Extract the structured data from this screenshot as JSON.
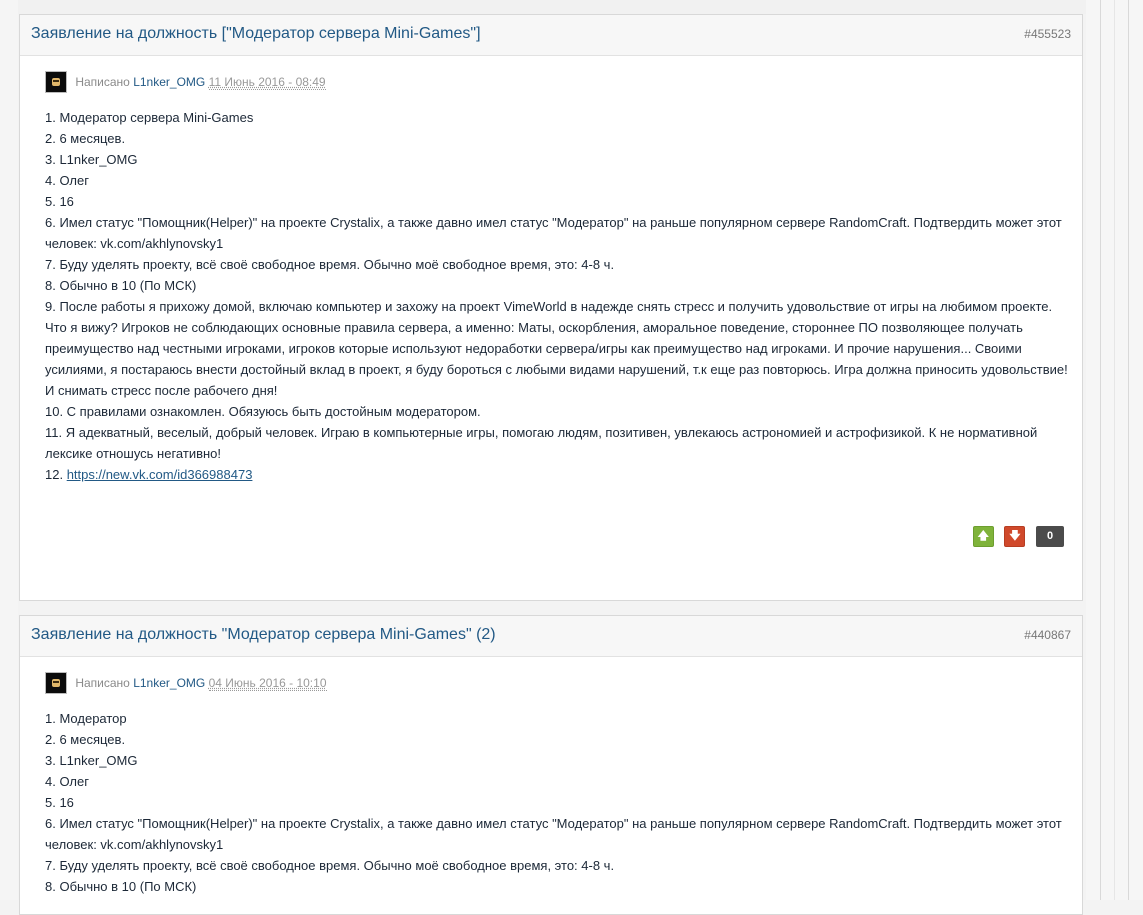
{
  "posts": [
    {
      "title": "Заявление на должность [\"Модератор сервера Mini-Games\"]",
      "number": "#455523",
      "written_by": "Написано",
      "author": "L1nker_OMG",
      "date": "11 Июнь 2016 - 08:49",
      "lines": [
        "1. Модератор сервера Mini-Games",
        "2. 6 месяцев.",
        "3. L1nker_OMG",
        "4. Олег",
        "5. 16",
        "6. Имел статус \"Помощник(Helper)\" на проекте Crystalix, а также давно имел статус \"Модератор\" на раньше популярном сервере RandomCraft. Подтвердить может этот человек: vk.com/akhlynovsky1",
        "7. Буду уделять проекту, всё своё свободное время. Обычно  моё свободное время, это: 4-8 ч.",
        "8. Обычно в 10 (По МСК)",
        "9. После работы я прихожу домой, включаю компьютер и захожу на проект VimeWorld в надежде снять стресс и получить удовольствие от игры на любимом проекте. Что я вижу? Игроков не соблюдающих основные правила сервера, а именно: Маты, оскорбления, аморальное поведение, стороннее ПО позволяющее получать преимущество над честными игроками, игроков которые используют недоработки сервера/игры как преимущество над игроками. И прочие нарушения... Своими усилиями, я постараюсь внести достойный вклад в проект, я буду бороться с любыми видами нарушений, т.к еще раз повторюсь. Игра должна приносить удовольствие! И снимать стресс после рабочего дня!",
        "10. С правилами ознакомлен. Обязуюсь быть достойным модератором.",
        "11. Я адекватный, веселый, добрый человек. Играю в компьютерные игры, помогаю людям, позитивен, увлекаюсь астрономией и астрофизикой. К не нормативной лексике отношусь негативно!"
      ],
      "last_line_prefix": "12. ",
      "last_line_link": "https://new.vk.com/id366988473",
      "rep_up_icon": "arrow-up-icon",
      "rep_down_icon": "arrow-down-icon",
      "rep_count": "0"
    },
    {
      "title": "Заявление на должность \"Модератор сервера Mini-Games\" (2)",
      "number": "#440867",
      "written_by": "Написано",
      "author": "L1nker_OMG",
      "date": "04 Июнь 2016 - 10:10",
      "lines": [
        "1. Модератор",
        "2. 6 месяцев.",
        "3. L1nker_OMG",
        "4. Олег",
        "5. 16",
        "6. Имел статус \"Помощник(Helper)\" на проекте Crystalix, а также давно имел статус \"Модератор\" на раньше популярном сервере RandomCraft. Подтвердить может этот человек: vk.com/akhlynovsky1",
        "7. Буду уделять проекту, всё своё свободное время. Обычно  моё свободное время, это: 4-8 ч.",
        "8. Обычно в 10 (По МСК)"
      ]
    }
  ]
}
